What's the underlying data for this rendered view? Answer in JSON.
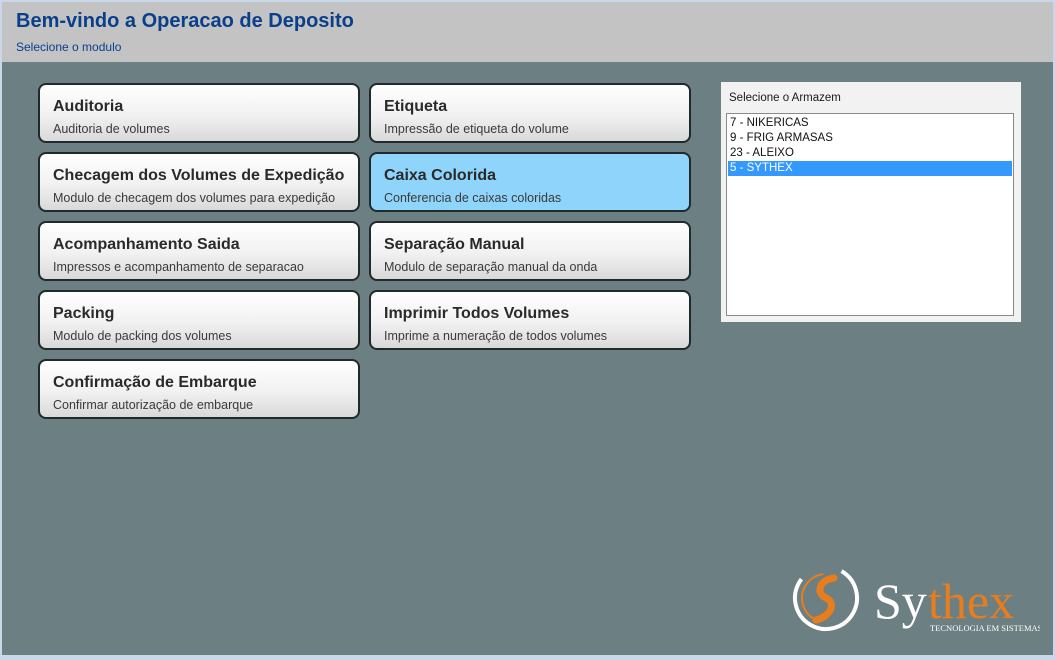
{
  "header": {
    "title": "Bem-vindo a Operacao de Deposito",
    "subtitle": "Selecione o modulo"
  },
  "modules": [
    {
      "title": "Auditoria",
      "description": "Auditoria de volumes"
    },
    {
      "title": "Etiqueta",
      "description": "Impressão de etiqueta do volume"
    },
    {
      "title": "Checagem dos Volumes de Expedição",
      "description": "Modulo de checagem dos volumes para expedição"
    },
    {
      "title": "Caixa Colorida",
      "description": "Conferencia de caixas coloridas",
      "selected": true
    },
    {
      "title": "Acompanhamento Saida",
      "description": "Impressos e acompanhamento de separacao"
    },
    {
      "title": "Separação Manual",
      "description": "Modulo de separação manual da onda"
    },
    {
      "title": "Packing",
      "description": "Modulo de packing dos volumes"
    },
    {
      "title": "Imprimir Todos Volumes",
      "description": "Imprime a numeração de todos volumes"
    },
    {
      "title": "Confirmação de Embarque",
      "description": "Confirmar autorização de embarque"
    }
  ],
  "warehouse": {
    "label": "Selecione o Armazem",
    "options": [
      "7 - NIKERICAS",
      "9 - FRIG ARMASAS",
      "23 - ALEIXO",
      "5 - SYTHEX"
    ],
    "selected_index": 3
  },
  "logo": {
    "name": "Sythex",
    "tagline": "TECNOLOGIA EM SISTEMAS"
  },
  "colors": {
    "title_blue": "#0a3f8c",
    "background": "#6c7f82",
    "header_bg": "#c3c3c3",
    "tile_selected": "#8fd4fb",
    "list_selected": "#3399ff",
    "logo_orange": "#e87d1e"
  }
}
